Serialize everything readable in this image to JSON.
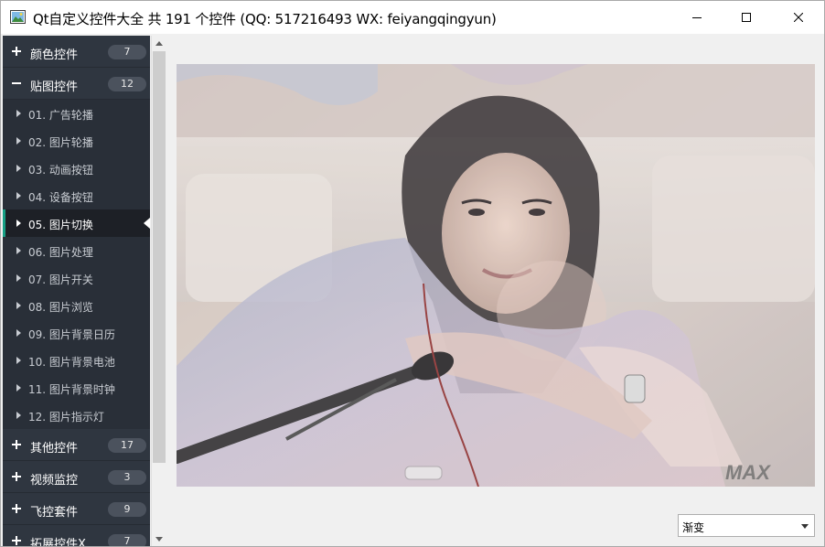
{
  "window": {
    "title": "Qt自定义控件大全 共 191 个控件 (QQ: 517216493 WX: feiyangqingyun)"
  },
  "nav": {
    "groups_top": [
      {
        "label": "颜色控件",
        "count": "7",
        "expanded": false
      },
      {
        "label": "贴图控件",
        "count": "12",
        "expanded": true
      }
    ],
    "children": [
      {
        "label": "01. 广告轮播"
      },
      {
        "label": "02. 图片轮播"
      },
      {
        "label": "03. 动画按钮"
      },
      {
        "label": "04. 设备按钮"
      },
      {
        "label": "05. 图片切换",
        "active": true
      },
      {
        "label": "06. 图片处理"
      },
      {
        "label": "07. 图片开关"
      },
      {
        "label": "08. 图片浏览"
      },
      {
        "label": "09. 图片背景日历"
      },
      {
        "label": "10. 图片背景电池"
      },
      {
        "label": "11. 图片背景时钟"
      },
      {
        "label": "12. 图片指示灯"
      }
    ],
    "groups_bottom": [
      {
        "label": "其他控件",
        "count": "17"
      },
      {
        "label": "视频监控",
        "count": "3"
      },
      {
        "label": "飞控套件",
        "count": "9"
      },
      {
        "label": "拓展控件X",
        "count": "7"
      }
    ]
  },
  "content": {
    "watermark": "MAX",
    "transition_select": {
      "value": "渐变"
    }
  },
  "colors": {
    "nav_bg": "#292f38",
    "group_bg": "#2f3640",
    "active_bg": "#1d2026",
    "accent": "#16a085",
    "badge_bg": "#4b525d"
  }
}
